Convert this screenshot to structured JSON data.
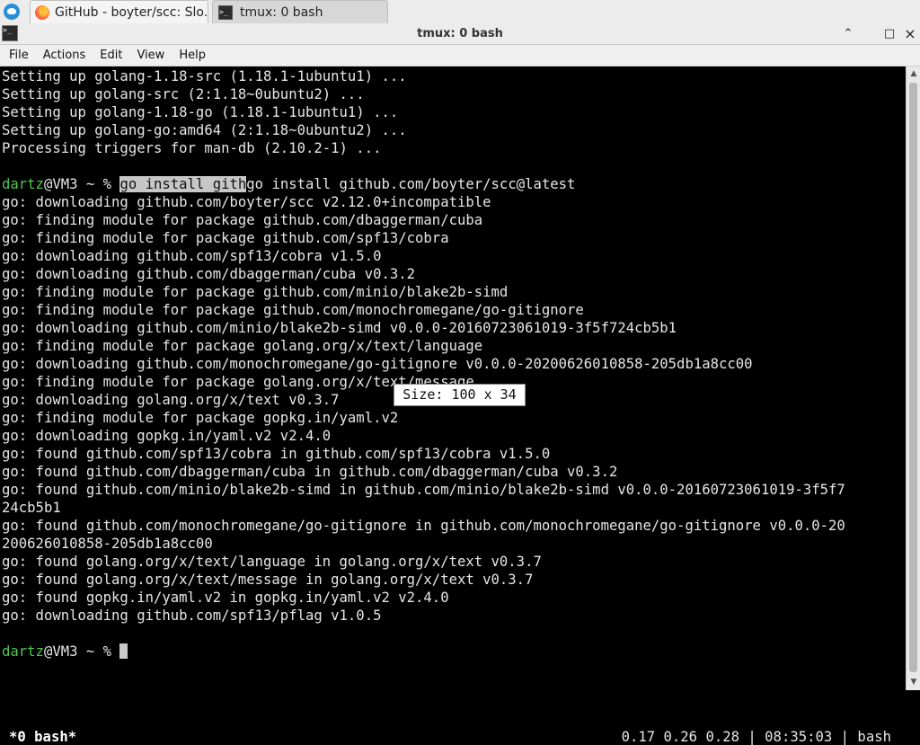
{
  "taskbar": {
    "tabs": [
      {
        "label": "GitHub - boyter/scc: Slo...",
        "icon": "firefox-icon",
        "active": true
      },
      {
        "label": "tmux: 0 bash",
        "icon": "terminal-icon",
        "active": false
      }
    ]
  },
  "window": {
    "title": "tmux: 0 bash",
    "controls": {
      "minimize": "⌃",
      "maximize": "□",
      "close": "×"
    }
  },
  "menu": {
    "items": [
      "File",
      "Actions",
      "Edit",
      "View",
      "Help"
    ]
  },
  "terminal": {
    "lines": [
      "Setting up golang-1.18-src (1.18.1-1ubuntu1) ...",
      "Setting up golang-src (2:1.18~0ubuntu2) ...",
      "Setting up golang-1.18-go (1.18.1-1ubuntu1) ...",
      "Setting up golang-go:amd64 (2:1.18~0ubuntu2) ...",
      "Processing triggers for man-db (2.10.2-1) ...",
      "",
      "",
      "go: downloading github.com/boyter/scc v2.12.0+incompatible",
      "go: finding module for package github.com/dbaggerman/cuba",
      "go: finding module for package github.com/spf13/cobra",
      "go: downloading github.com/spf13/cobra v1.5.0",
      "go: downloading github.com/dbaggerman/cuba v0.3.2",
      "go: finding module for package github.com/minio/blake2b-simd",
      "go: finding module for package github.com/monochromegane/go-gitignore",
      "go: downloading github.com/minio/blake2b-simd v0.0.0-20160723061019-3f5f724cb5b1",
      "go: finding module for package golang.org/x/text/language",
      "go: downloading github.com/monochromegane/go-gitignore v0.0.0-20200626010858-205db1a8cc00",
      "go: finding module for package golang.org/x/text/message",
      "go: downloading golang.org/x/text v0.3.7",
      "go: finding module for package gopkg.in/yaml.v2",
      "go: downloading gopkg.in/yaml.v2 v2.4.0",
      "go: found github.com/spf13/cobra in github.com/spf13/cobra v1.5.0",
      "go: found github.com/dbaggerman/cuba in github.com/dbaggerman/cuba v0.3.2",
      "go: found github.com/minio/blake2b-simd in github.com/minio/blake2b-simd v0.0.0-20160723061019-3f5f7",
      "24cb5b1",
      "go: found github.com/monochromegane/go-gitignore in github.com/monochromegane/go-gitignore v0.0.0-20",
      "200626010858-205db1a8cc00",
      "go: found golang.org/x/text/language in golang.org/x/text v0.3.7",
      "go: found golang.org/x/text/message in golang.org/x/text v0.3.7",
      "go: found gopkg.in/yaml.v2 in gopkg.in/yaml.v2 v2.4.0",
      "go: downloading github.com/spf13/pflag v1.0.5",
      "",
      ""
    ],
    "prompt": {
      "user": "dartz",
      "host_path": "@VM3 ~ % "
    },
    "command": {
      "selected": "go install gith",
      "rest": "go install github.com/boyter/scc@latest"
    }
  },
  "tooltip": {
    "text": "Size: 100 x 34"
  },
  "status": {
    "left": "*0 bash*",
    "right": "0.17 0.26 0.28 | 08:35:03 | bash"
  }
}
